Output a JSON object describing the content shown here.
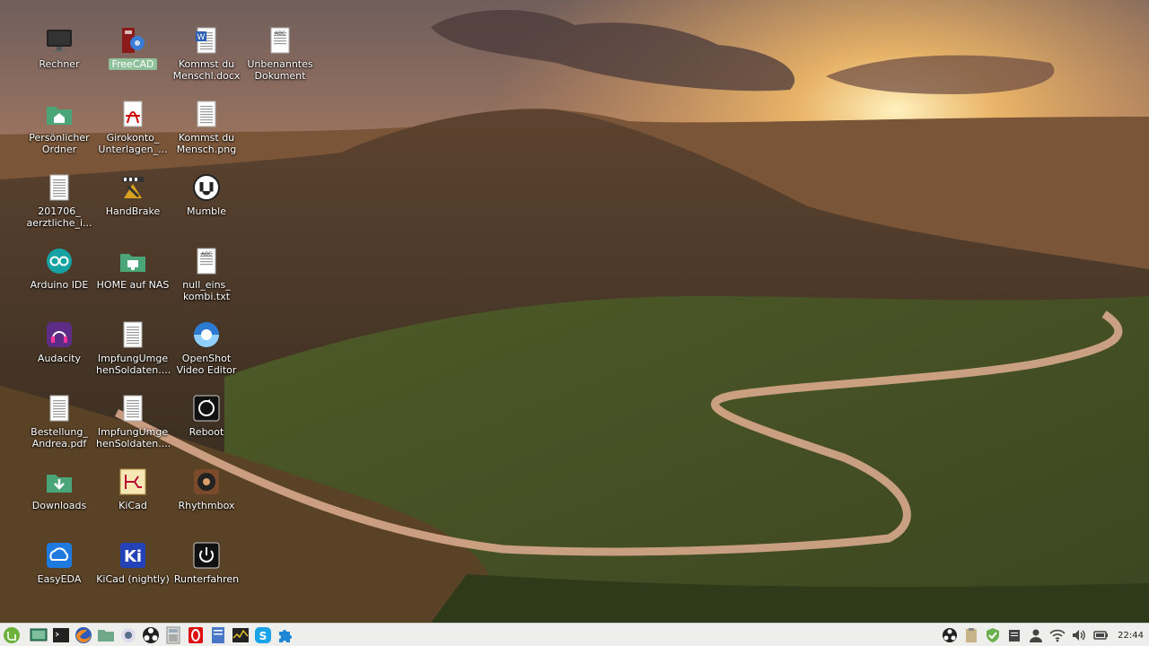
{
  "desktop": {
    "icons": [
      {
        "label": "Rechner",
        "icon": "monitor-icon"
      },
      {
        "label": "FreeCAD",
        "icon": "freecad-icon",
        "selected": true
      },
      {
        "label": "Kommst du Menschl.docx",
        "icon": "word-document-icon"
      },
      {
        "label": "Unbenanntes Dokument",
        "icon": "text-document-icon"
      },
      {
        "label": "Persönlicher Ordner",
        "icon": "home-folder-icon"
      },
      {
        "label": "Girokonto_ Unterlagen_...",
        "icon": "pdf-icon"
      },
      {
        "label": "Kommst du Mensch.png",
        "icon": "image-file-icon"
      },
      {
        "label": "201706_ aerztliche_i...",
        "icon": "document-icon"
      },
      {
        "label": "HandBrake",
        "icon": "handbrake-icon"
      },
      {
        "label": "Mumble",
        "icon": "mumble-icon"
      },
      {
        "label": "Arduino IDE",
        "icon": "arduino-icon"
      },
      {
        "label": "HOME auf NAS",
        "icon": "network-folder-icon"
      },
      {
        "label": "null_eins_ kombi.txt",
        "icon": "text-document-icon"
      },
      {
        "label": "Audacity",
        "icon": "audacity-icon"
      },
      {
        "label": "ImpfungUmge henSoldaten....",
        "icon": "document-icon"
      },
      {
        "label": "OpenShot Video Editor",
        "icon": "openshot-icon"
      },
      {
        "label": "Bestellung_ Andrea.pdf",
        "icon": "document-icon"
      },
      {
        "label": "ImpfungUmge henSoldaten....",
        "icon": "document-icon"
      },
      {
        "label": "Reboot",
        "icon": "reboot-icon"
      },
      {
        "label": "Downloads",
        "icon": "downloads-folder-icon"
      },
      {
        "label": "KiCad",
        "icon": "kicad-icon"
      },
      {
        "label": "Rhythmbox",
        "icon": "rhythmbox-icon"
      },
      {
        "label": "EasyEDA",
        "icon": "easyeda-icon"
      },
      {
        "label": "KiCad (nightly)",
        "icon": "kicad-nightly-icon"
      },
      {
        "label": "Runterfahren",
        "icon": "shutdown-icon"
      }
    ]
  },
  "panel": {
    "launchers": [
      "mint-menu-icon",
      "show-desktop-icon",
      "terminal-icon",
      "firefox-icon",
      "files-icon",
      "settings-icon",
      "obs-icon",
      "calculator-icon",
      "opera-icon",
      "text-editor-icon",
      "system-monitor-icon",
      "skype-icon",
      "puzzle-icon"
    ],
    "tray": [
      "obs-tray-icon",
      "clipboard-icon",
      "shield-check-icon",
      "notes-icon",
      "user-icon",
      "wifi-icon",
      "volume-icon",
      "battery-icon"
    ],
    "clock": "22:44"
  },
  "colors": {
    "panel_bg": "#eeeeec",
    "selection": "#8fc19a",
    "sky_top": "#7a6a66",
    "sun": "#ffd27a"
  }
}
